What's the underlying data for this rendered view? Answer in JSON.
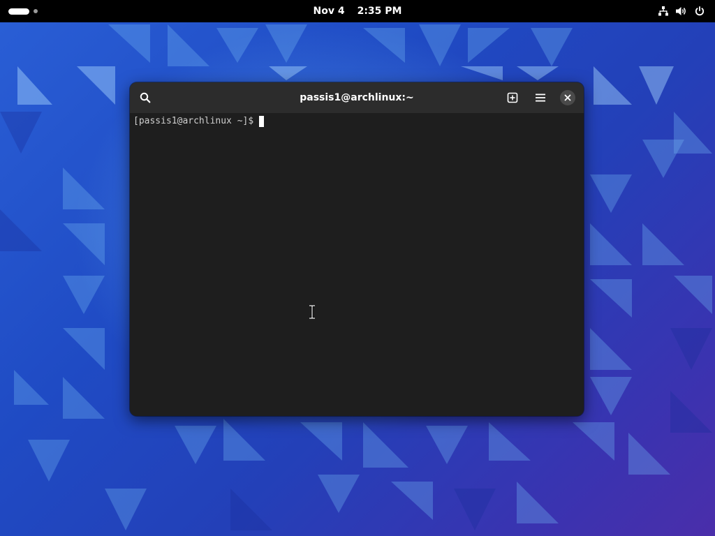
{
  "topbar": {
    "date": "Nov 4",
    "time": "2:35 PM",
    "tray_icons": [
      "network-icon",
      "volume-icon",
      "power-icon"
    ]
  },
  "terminal": {
    "title": "passis1@archlinux:~",
    "prompt": "[passis1@archlinux ~]$",
    "header_buttons": [
      "search-icon",
      "new-tab-icon",
      "hamburger-menu-icon",
      "close-icon"
    ]
  },
  "colors": {
    "topbar_bg": "#000000",
    "headerbar_bg": "#2c2c2c",
    "terminal_bg": "#1e1e1e",
    "wallpaper_blue": "#2a5fd6"
  }
}
